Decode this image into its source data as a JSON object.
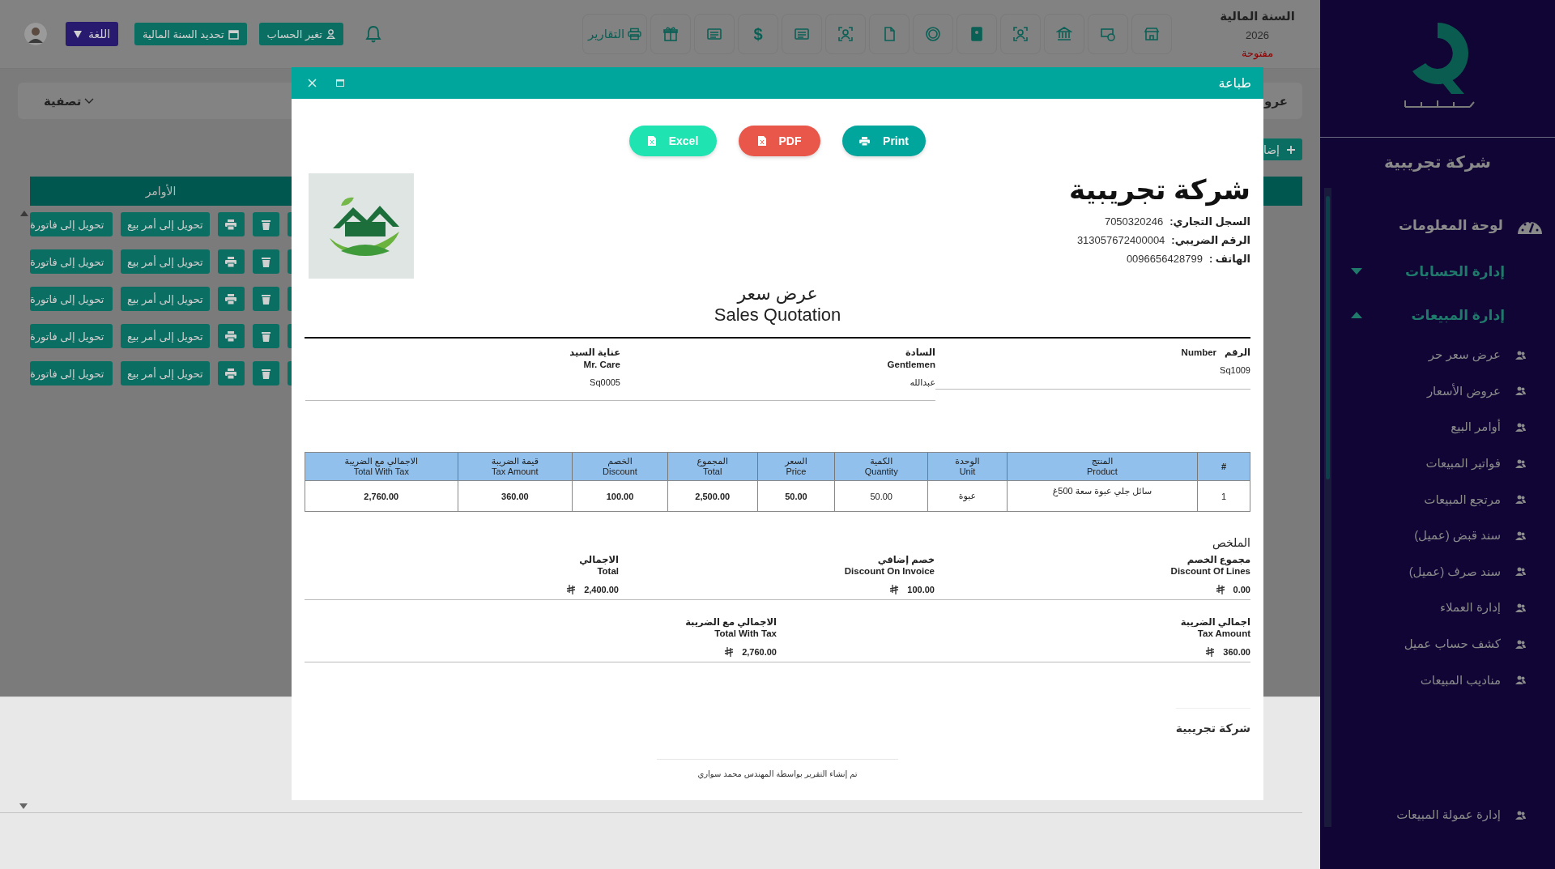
{
  "topbar": {
    "language": "اللغة",
    "set_fiscal_year": "تحديد السنة المالية",
    "change_account": "تغير الحساب",
    "reports": "التقارير",
    "currency_symbol": "$",
    "fiscal_year": {
      "label": "السنة المالية",
      "year": "2026",
      "status": "مفتوحة"
    }
  },
  "page": {
    "filter": "تصفية",
    "cut_title": "عرو",
    "add_button": "إضا",
    "table": {
      "column": "الأوامر",
      "rows": [
        {
          "to_invoice": "تحويل إلى فاتورة",
          "to_order": "تحويل إلى أمر بيع"
        },
        {
          "to_invoice": "تحويل إلى فاتورة",
          "to_order": "تحويل إلى أمر بيع"
        },
        {
          "to_invoice": "تحويل إلى فاتورة",
          "to_order": "تحويل إلى أمر بيع"
        },
        {
          "to_invoice": "تحويل إلى فاتورة",
          "to_order": "تحويل إلى أمر بيع"
        },
        {
          "to_invoice": "تحويل إلى فاتورة",
          "to_order": "تحويل إلى أمر بيع"
        }
      ]
    }
  },
  "sidebar": {
    "company": "شركة تجريبية",
    "items": [
      {
        "label": "لوحة المعلومات",
        "kind": "dashboard"
      },
      {
        "label": "إدارة الحسابات",
        "kind": "group",
        "expanded": false
      },
      {
        "label": "إدارة المبيعات",
        "kind": "group",
        "expanded": true,
        "children": [
          {
            "label": "عرض سعر حر"
          },
          {
            "label": "عروض الأسعار"
          },
          {
            "label": "أوامر البيع"
          },
          {
            "label": "فواتير المبيعات"
          },
          {
            "label": "مرتجع المبيعات"
          },
          {
            "label": "سند قبض (عميل)"
          },
          {
            "label": "سند صرف (عميل)"
          },
          {
            "label": "إدارة العملاء"
          },
          {
            "label": "كشف حساب عميل"
          },
          {
            "label": "مناديب المبيعات"
          }
        ]
      }
    ],
    "bottom_item": {
      "label": "إدارة عمولة المبيعات"
    }
  },
  "modal": {
    "title": "طباعة",
    "buttons": [
      {
        "label": "Print",
        "kind": "print"
      },
      {
        "label": "PDF",
        "kind": "pdf"
      },
      {
        "label": "Excel",
        "kind": "excel"
      }
    ],
    "company": {
      "name": "شركة تجريبية",
      "fields": [
        {
          "label": "السجل التجاري:",
          "value": "7050320246"
        },
        {
          "label": "الرقم الضريبي:",
          "value": "313057672400004"
        },
        {
          "label": "الهاتف :",
          "value": "0096656428799"
        }
      ]
    },
    "title_ar": "عرض سعر",
    "title_en": "Sales Quotation",
    "info": [
      {
        "kind": "inline",
        "label_ar": "الرقم",
        "label_en": "Number",
        "value": "Sq1009"
      },
      {
        "kind": "stacked",
        "label_ar": "السادة",
        "label_en": "Gentlemen",
        "value": "عبدالله"
      },
      {
        "kind": "stacked",
        "label_ar": "عناية السيد",
        "label_en": "Mr. Care",
        "value": "Sq0005"
      }
    ],
    "table": {
      "columns": [
        {
          "ar": "#",
          "bold": false
        },
        {
          "ar": "المنتج",
          "en": "Product",
          "bold": false
        },
        {
          "ar": "الوحدة",
          "en": "Unit",
          "bold": false
        },
        {
          "ar": "الكمية",
          "en": "Quantity",
          "bold": false
        },
        {
          "ar": "السعر",
          "en": "Price",
          "bold": true
        },
        {
          "ar": "المجموع",
          "en": "Total",
          "bold": true
        },
        {
          "ar": "الخصم",
          "en": "Discount",
          "bold": true
        },
        {
          "ar": "قيمة الضريبة",
          "en": "Tax Amount",
          "bold": true
        },
        {
          "ar": "الاجمالي مع الضريبة",
          "en": "Total With Tax",
          "bold": true
        }
      ],
      "rows": [
        [
          "1",
          "سائل جلي عبوة سعة 500غ",
          "عبوة",
          "50.00",
          "50.00",
          "2,500.00",
          "100.00",
          "360.00",
          "2,760.00"
        ]
      ]
    },
    "summary": {
      "title": "الملخص",
      "rows": [
        [
          {
            "ar": "مجموع الخصم",
            "en": "Discount Of Lines",
            "value": "0.00"
          },
          {
            "ar": "خصم إضافي",
            "en": "Discount On Invoice",
            "value": "100.00"
          },
          {
            "ar": "الاجمالي",
            "en": "Total",
            "value": "2,400.00"
          }
        ],
        [
          {
            "ar": "اجمالي الضريبة",
            "en": "Tax Amount",
            "value": "360.00"
          },
          {
            "ar": "الاجمالي مع الضريبة",
            "en": "Total With Tax",
            "value": "2,760.00"
          }
        ]
      ]
    },
    "footer": {
      "company": "شركة تجريبية",
      "credit": "تم إنشاء التقرير بواسطة المهندس محمد سواري"
    }
  }
}
